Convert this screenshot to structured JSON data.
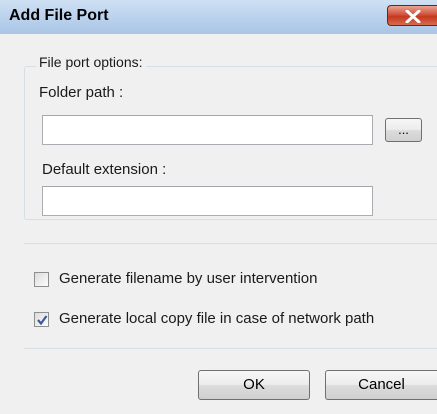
{
  "window": {
    "title": "Add File Port",
    "close_icon": "close-x-icon",
    "accent_close": "#c4391f"
  },
  "group": {
    "legend": "File port options:",
    "folder_path_label": "Folder path :",
    "folder_path_value": "",
    "browse_label": "...",
    "default_extension_label": "Default extension :",
    "default_extension_value": ""
  },
  "options": {
    "user_intervention_label": "Generate filename by user intervention",
    "user_intervention_checked": false,
    "local_copy_label": "Generate local copy file in case of network path",
    "local_copy_checked": true
  },
  "buttons": {
    "ok_label": "OK",
    "cancel_label": "Cancel"
  }
}
